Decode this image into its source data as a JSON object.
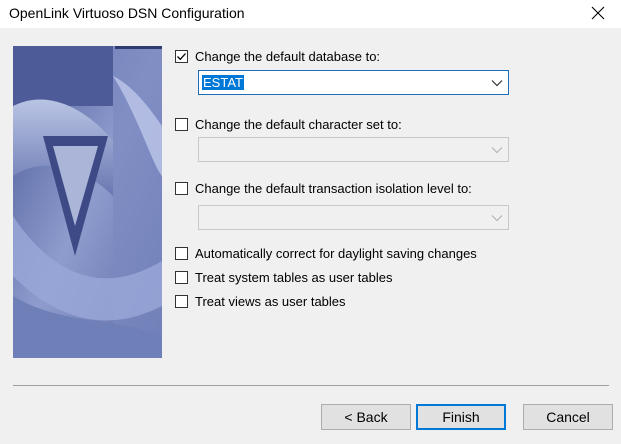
{
  "window": {
    "title": "OpenLink Virtuoso DSN Configuration"
  },
  "options": {
    "default_database": {
      "label": "Change the default database to:",
      "checked": true,
      "value": "ESTAT"
    },
    "default_charset": {
      "label": "Change the default character set to:",
      "checked": false,
      "value": ""
    },
    "default_isolation": {
      "label": "Change the default transaction isolation level to:",
      "checked": false,
      "value": ""
    },
    "daylight": {
      "label": "Automatically correct for daylight saving changes",
      "checked": false
    },
    "system_tables": {
      "label": "Treat system tables as user tables",
      "checked": false
    },
    "views": {
      "label": "Treat views as user tables",
      "checked": false
    }
  },
  "buttons": {
    "back": "< Back",
    "finish": "Finish",
    "cancel": "Cancel"
  },
  "colors": {
    "accent": "#0078d7",
    "background": "#f0f0f0",
    "banner": "#6f7fb6"
  },
  "icons": {
    "close": "close-icon",
    "checkmark": "checkmark-icon",
    "dropdown": "chevron-down-icon"
  }
}
